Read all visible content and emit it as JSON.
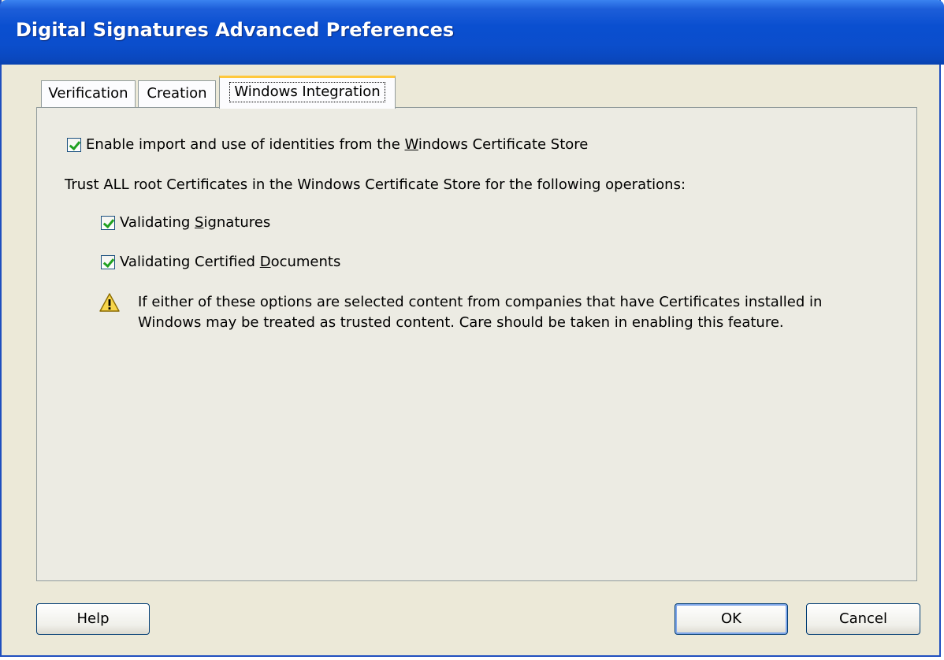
{
  "window": {
    "title": "Digital Signatures Advanced Preferences"
  },
  "tabs": [
    {
      "label": "Verification",
      "active": false
    },
    {
      "label": "Creation",
      "active": false
    },
    {
      "label": "Windows Integration",
      "active": true
    }
  ],
  "panel": {
    "enable_import": {
      "checked": true,
      "label_pre": "Enable import and use of identities from the ",
      "label_u": "W",
      "label_post": "indows Certificate Store"
    },
    "trust_heading": "Trust ALL root Certificates in the Windows Certificate Store for the following operations:",
    "validating_signatures": {
      "checked": true,
      "label_pre": "Validating ",
      "label_u": "S",
      "label_post": "ignatures"
    },
    "validating_certified": {
      "checked": true,
      "label_pre": "Validating Certified ",
      "label_u": "D",
      "label_post": "ocuments"
    },
    "warning_icon": "warning-triangle-icon",
    "warning_line1": "If either of these options are selected content from companies that have Certificates installed in",
    "warning_line2": "Windows may be treated as trusted content. Care should be taken in enabling this feature."
  },
  "buttons": {
    "help": "Help",
    "ok": "OK",
    "cancel": "Cancel"
  },
  "colors": {
    "titlebar": "#0a4fd0",
    "dialog_bg": "#ece9d8",
    "active_tab_accent": "#ffc83c",
    "check": "#21a121"
  }
}
